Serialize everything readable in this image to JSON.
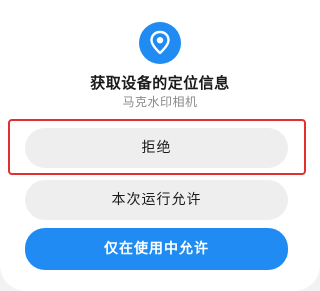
{
  "colors": {
    "accent": "#1f8bf3",
    "button_gray": "#eeeeef",
    "highlight": "#e03030"
  },
  "dialog": {
    "icon": "location-pin-icon",
    "title": "获取设备的定位信息",
    "app_name": "马克水印相机",
    "buttons": {
      "deny": "拒绝",
      "allow_once": "本次运行允许",
      "allow_while_using": "仅在使用中允许"
    }
  }
}
